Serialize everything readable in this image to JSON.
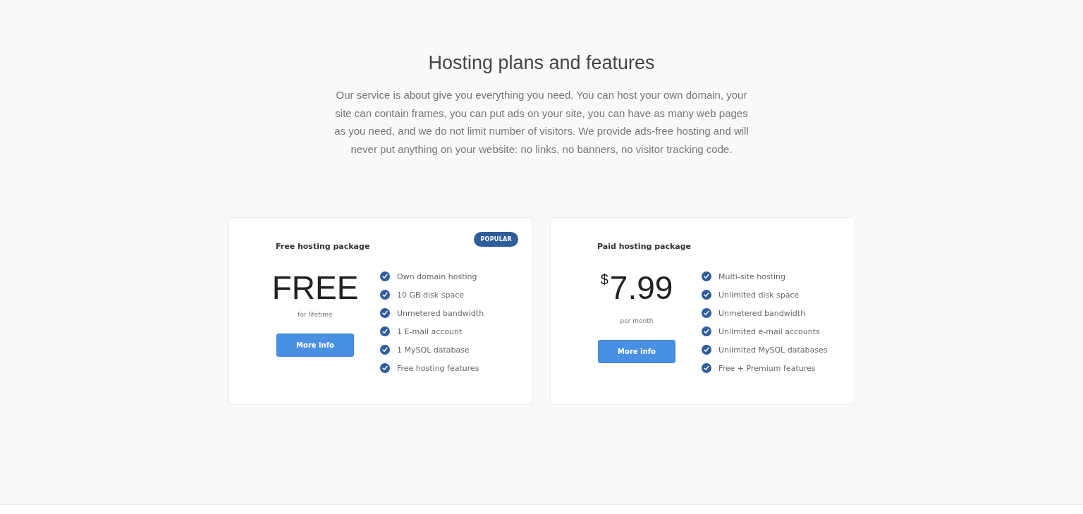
{
  "section": {
    "title": "Hosting plans and features",
    "description": "Our service is about give you everything you need. You can host your own domain, your site can contain frames, you can put ads on your site, you can have as many web pages as you need, and we do not limit number of visitors. We provide ads-free hosting and will never put anything on your website: no links, no banners, no visitor tracking code."
  },
  "plans": [
    {
      "name": "Free hosting package",
      "badge": "POPULAR",
      "price": {
        "amount": "FREE"
      },
      "period": "for lifetime",
      "button": "More info",
      "features": [
        "Own domain hosting",
        "10 GB disk space",
        "Unmetered bandwidth",
        "1 E-mail account",
        "1 MySQL database",
        "Free hosting features"
      ]
    },
    {
      "name": "Paid hosting package",
      "price": {
        "currency": "$",
        "amount": "7.99"
      },
      "period": "per month",
      "button": "More info",
      "features": [
        "Multi-site hosting",
        "Unlimited disk space",
        "Unmetered bandwidth",
        "Unlimited e-mail accounts",
        "Unlimited MySQL databases",
        "Free + Premium features"
      ]
    }
  ]
}
